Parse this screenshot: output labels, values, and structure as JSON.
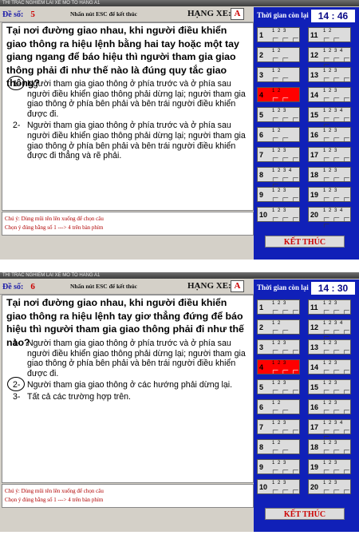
{
  "screens": [
    {
      "window_title": "THI TRAC NGHIEM LAI XE  MO TO  HANG A1",
      "de_so_label": "Đề số:",
      "de_so_value": "5",
      "esc_hint": "Nhấn nút ESC để kết thúc",
      "hang_xe_label": "HẠNG XE:",
      "hang_xe_value": "A",
      "time_label": "Thời gian còn lại",
      "time_min": "14",
      "time_sec": "46",
      "question": "Tại nơi đường giao nhau, khi người điều khiển giao thông ra hiệu lệnh bằng hai tay hoặc một tay giang ngang để báo hiệu thì người tham gia giao thông phải đi như thế nào là đúng quy tắc giao thông?",
      "answers": [
        {
          "num": "1-",
          "text": "Người tham gia giao thông ở phía trước và ở phía sau người điều khiển giao thông phải dừng lại; người tham gia giao thông ở phía bên phải và bên trái người điều khiển được đi.",
          "selected": true
        },
        {
          "num": "2-",
          "text": "Người tham gia giao thông ở phía trước và ở phía sau người điều khiển giao thông phải dừng lại; người tham gia giao thông ở phía bên phải và bên trái người điều khiển được đi thẳng và rẽ phải.",
          "selected": false
        }
      ],
      "note_line1": "Chú ý: Dùng mũi tên lên xuống để chọn câu",
      "note_line2": "Chọn ý đúng bằng số 1 ---> 4 trên bàn phím",
      "finish_label": "KẾT THÚC",
      "cells": [
        {
          "n": "1",
          "opts": "1 2 3"
        },
        {
          "n": "11",
          "opts": "1 2"
        },
        {
          "n": "2",
          "opts": "1 2"
        },
        {
          "n": "12",
          "opts": "1 2 3 4"
        },
        {
          "n": "3",
          "opts": "1 2"
        },
        {
          "n": "13",
          "opts": "1 2 3"
        },
        {
          "n": "4",
          "opts": "1 2",
          "active": true
        },
        {
          "n": "14",
          "opts": "1 2 3"
        },
        {
          "n": "5",
          "opts": "1 2 3"
        },
        {
          "n": "15",
          "opts": "1 2 3 4"
        },
        {
          "n": "6",
          "opts": "1 2"
        },
        {
          "n": "16",
          "opts": "1 2 3"
        },
        {
          "n": "7",
          "opts": "1 2 3"
        },
        {
          "n": "17",
          "opts": "1 2 3"
        },
        {
          "n": "8",
          "opts": "1 2 3 4"
        },
        {
          "n": "18",
          "opts": "1 2 3"
        },
        {
          "n": "9",
          "opts": "1 2 3"
        },
        {
          "n": "19",
          "opts": "1 2 3"
        },
        {
          "n": "10",
          "opts": "1 2 3"
        },
        {
          "n": "20",
          "opts": "1 2 3 4"
        }
      ]
    },
    {
      "window_title": "THI TRAC NGHIEM LAI XE  MO TO  HANG A1",
      "de_so_label": "Đề số:",
      "de_so_value": "6",
      "esc_hint": "Nhấn nút ESC để kết thúc",
      "hang_xe_label": "HẠNG XE:",
      "hang_xe_value": "A",
      "time_label": "Thời gian còn lại",
      "time_min": "14",
      "time_sec": "30",
      "question": "Tại nơi đường giao nhau, khi người điều khiển giao thông ra hiệu lệnh tay giơ thẳng đứng để báo hiệu thì người tham gia giao thông phải đi như thế nào?",
      "answers": [
        {
          "num": "1-",
          "text": "Người tham gia giao thông ở phía trước và ở phía sau người điều khiển giao thông phải dừng lại; người tham gia giao thông ở phía bên phải và bên trái người điều khiển được đi.",
          "selected": false
        },
        {
          "num": "2-",
          "text": "Người tham gia giao thông ở các hướng phải dừng lại.",
          "selected": true
        },
        {
          "num": "3-",
          "text": "Tất cả các trường hợp trên.",
          "selected": false
        }
      ],
      "note_line1": "Chú ý: Dùng mũi tên lên xuống để chọn câu",
      "note_line2": "Chọn ý đúng bằng số 1 ---> 4 trên bàn phím",
      "finish_label": "KẾT THÚC",
      "cells": [
        {
          "n": "1",
          "opts": "1 2 3"
        },
        {
          "n": "11",
          "opts": "1 2 3"
        },
        {
          "n": "2",
          "opts": "1 2"
        },
        {
          "n": "12",
          "opts": "1 2 3 4"
        },
        {
          "n": "3",
          "opts": "1 2 3"
        },
        {
          "n": "13",
          "opts": "1 2 3"
        },
        {
          "n": "4",
          "opts": "1 2 3",
          "active": true
        },
        {
          "n": "14",
          "opts": "1 2 3"
        },
        {
          "n": "5",
          "opts": "1 2 3"
        },
        {
          "n": "15",
          "opts": "1 2 3"
        },
        {
          "n": "6",
          "opts": "1 2"
        },
        {
          "n": "16",
          "opts": "1 2 3"
        },
        {
          "n": "7",
          "opts": "1 2 3"
        },
        {
          "n": "17",
          "opts": "1 2 3 4"
        },
        {
          "n": "8",
          "opts": "1 2"
        },
        {
          "n": "18",
          "opts": "1 2 3"
        },
        {
          "n": "9",
          "opts": "1 2 3"
        },
        {
          "n": "19",
          "opts": "1 2 3"
        },
        {
          "n": "10",
          "opts": "1 2 3"
        },
        {
          "n": "20",
          "opts": "1 2 3"
        }
      ]
    }
  ]
}
